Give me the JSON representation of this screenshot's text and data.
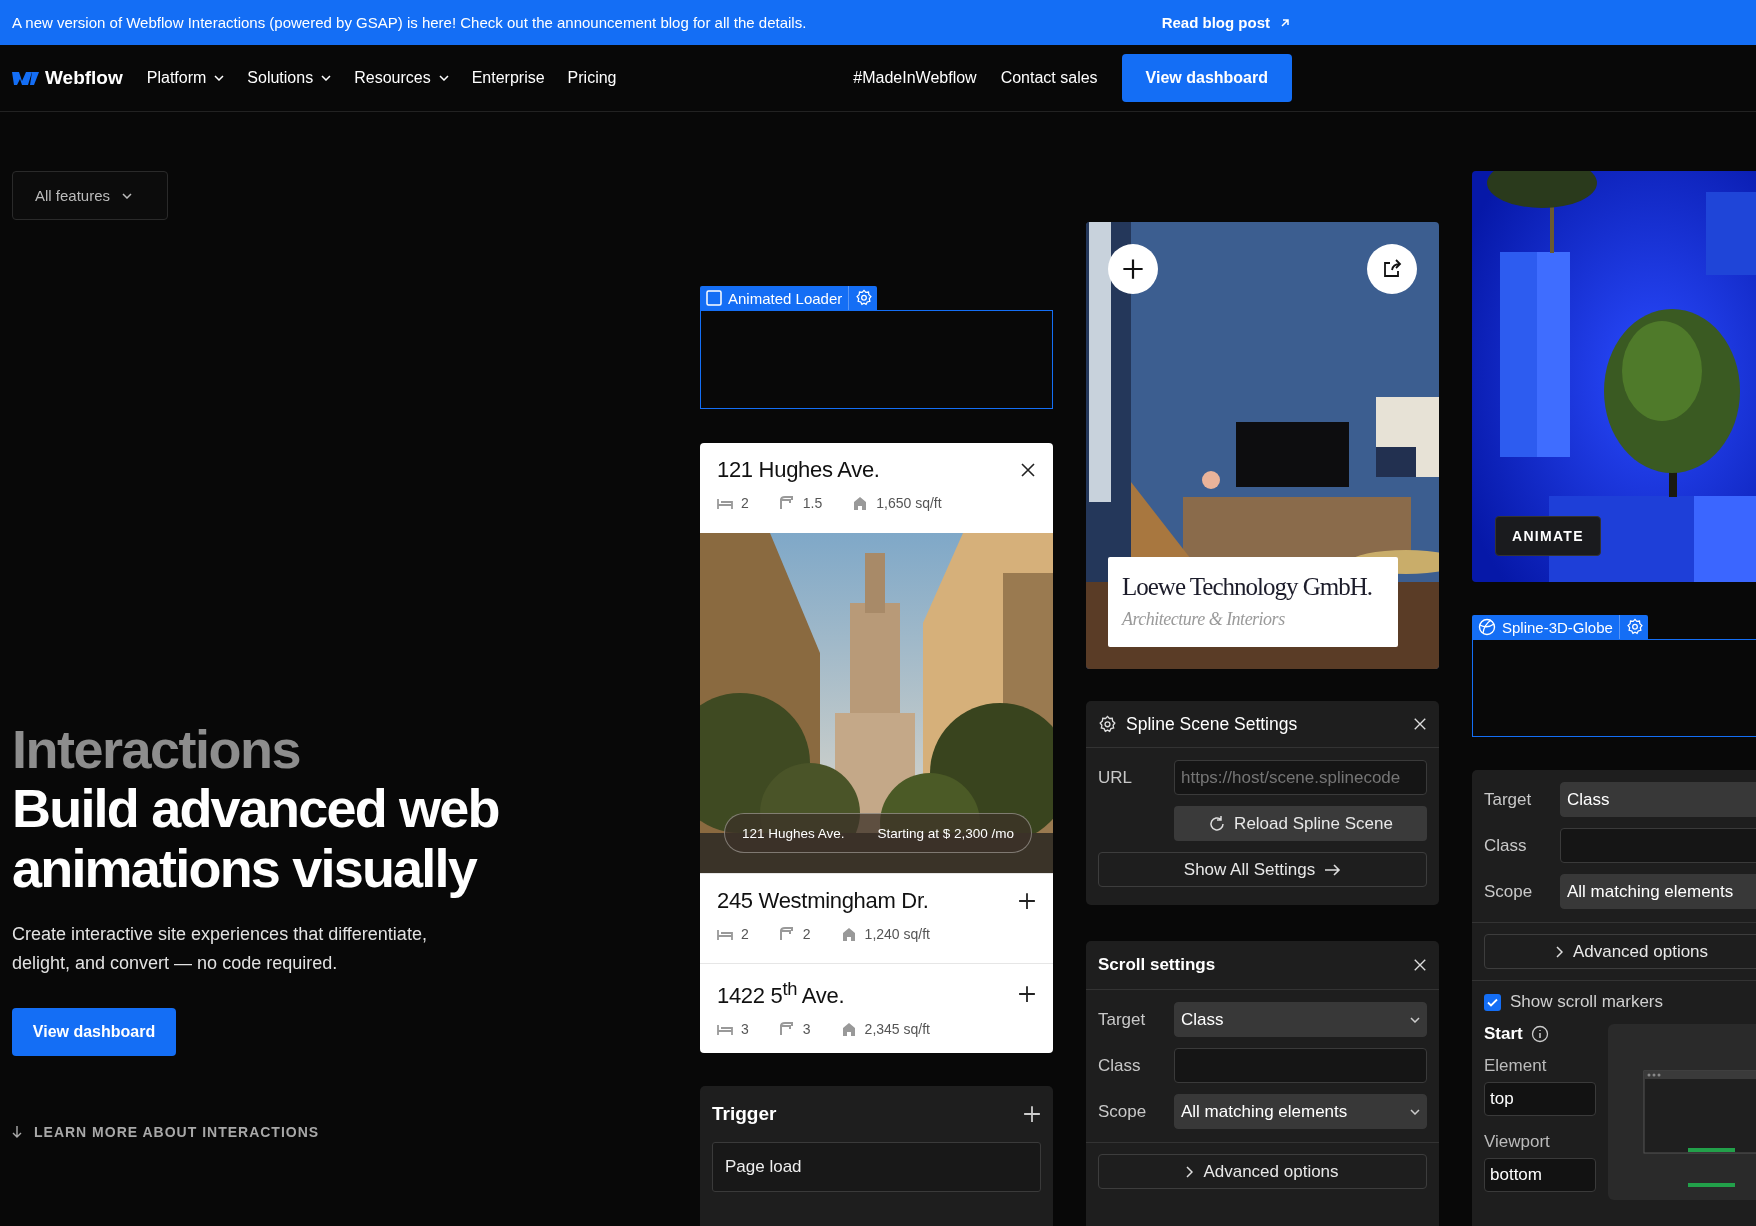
{
  "banner": {
    "text": "A new version of Webflow Interactions (powered by GSAP) is here! Check out the announcement blog for all the details.",
    "link": "Read blog post"
  },
  "nav": {
    "logo": "Webflow",
    "items": [
      {
        "label": "Platform",
        "dropdown": true
      },
      {
        "label": "Solutions",
        "dropdown": true
      },
      {
        "label": "Resources",
        "dropdown": true
      },
      {
        "label": "Enterprise",
        "dropdown": false
      },
      {
        "label": "Pricing",
        "dropdown": false
      }
    ],
    "right_links": [
      "#MadeInWebflow",
      "Contact sales"
    ],
    "cta": "View dashboard"
  },
  "filter": {
    "label": "All features"
  },
  "hero": {
    "eyebrow": "Interactions",
    "title": "Build advanced web animations visually",
    "subtitle": "Create interactive site experiences that differentiate, delight, and convert — no code required.",
    "button": "View dashboard",
    "learn_more": "LEARN MORE ABOUT INTERACTIONS"
  },
  "showcase": {
    "loader_tag": {
      "label": "Animated Loader"
    },
    "listings": [
      {
        "title": "121 Hughes Ave.",
        "beds": "2",
        "baths": "1.5",
        "area": "1,650 sq/ft",
        "expanded": true,
        "tag_name": "121 Hughes Ave.",
        "tag_price": "Starting at $ 2,300 /mo"
      },
      {
        "title": "245 Westmingham Dr.",
        "beds": "2",
        "baths": "2",
        "area": "1,240 sq/ft",
        "expanded": false
      },
      {
        "title": "1422 5$^{th}$ Ave.",
        "beds": "3",
        "baths": "3",
        "area": "2,345 sq/ft",
        "expanded": false
      }
    ],
    "trigger": {
      "title": "Trigger",
      "value": "Page load"
    },
    "brand_card": {
      "title": "Loewe Technology GmbH.",
      "subtitle": "Architecture & Interiors"
    },
    "spline_settings": {
      "title": "Spline Scene Settings",
      "url_label": "URL",
      "url_placeholder": "https://host/scene.splinecode",
      "reload": "Reload Spline Scene",
      "show_all": "Show All Settings"
    },
    "scroll_settings": {
      "title": "Scroll settings",
      "fields": [
        {
          "label": "Target",
          "kind": "select",
          "value": "Class"
        },
        {
          "label": "Class",
          "kind": "input"
        },
        {
          "label": "Scope",
          "kind": "select",
          "value": "All matching elements"
        }
      ],
      "advanced": "Advanced options"
    },
    "tree_scene": {
      "button": "ANIMATE"
    },
    "globe_tag": {
      "label": "Spline-3D-Globe"
    },
    "scroll_panel": {
      "fields": [
        {
          "label": "Target",
          "kind": "select",
          "value": "Class"
        },
        {
          "label": "Class",
          "kind": "input"
        },
        {
          "label": "Scope",
          "kind": "select",
          "value": "All matching elements"
        }
      ],
      "advanced": "Advanced options",
      "show_markers": {
        "label": "Show scroll markers",
        "checked": true
      },
      "start": {
        "title": "Start",
        "element_label": "Element",
        "element_value": "top",
        "viewport_label": "Viewport",
        "viewport_value": "bottom"
      }
    }
  }
}
